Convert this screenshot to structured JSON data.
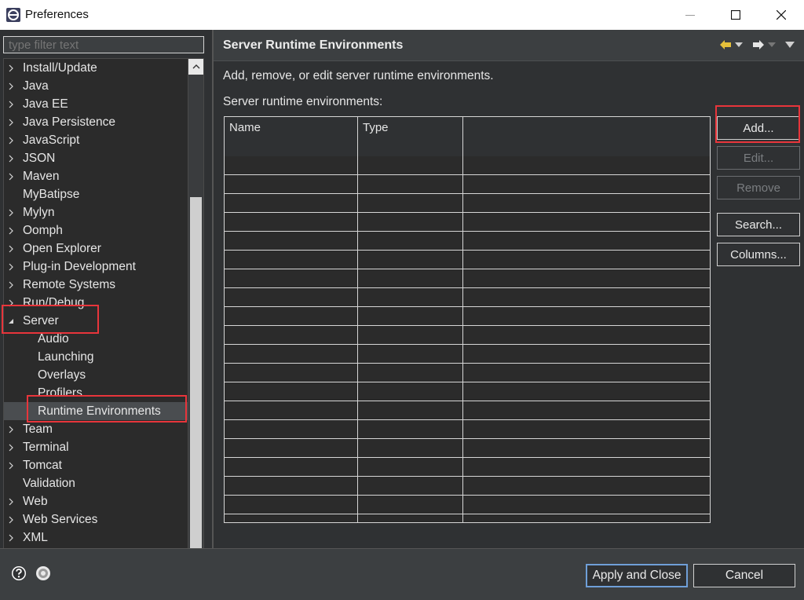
{
  "window": {
    "title": "Preferences"
  },
  "sidebar": {
    "filter_placeholder": "type filter text",
    "items": [
      {
        "label": "Install/Update",
        "expandable": true
      },
      {
        "label": "Java",
        "expandable": true
      },
      {
        "label": "Java EE",
        "expandable": true
      },
      {
        "label": "Java Persistence",
        "expandable": true
      },
      {
        "label": "JavaScript",
        "expandable": true
      },
      {
        "label": "JSON",
        "expandable": true
      },
      {
        "label": "Maven",
        "expandable": true
      },
      {
        "label": "MyBatipse",
        "expandable": false
      },
      {
        "label": "Mylyn",
        "expandable": true
      },
      {
        "label": "Oomph",
        "expandable": true
      },
      {
        "label": "Open Explorer",
        "expandable": true
      },
      {
        "label": "Plug-in Development",
        "expandable": true
      },
      {
        "label": "Remote Systems",
        "expandable": true
      },
      {
        "label": "Run/Debug",
        "expandable": true
      },
      {
        "label": "Server",
        "expandable": true,
        "expanded": true
      },
      {
        "label": "Audio",
        "child": true
      },
      {
        "label": "Launching",
        "child": true
      },
      {
        "label": "Overlays",
        "child": true
      },
      {
        "label": "Profilers",
        "child": true
      },
      {
        "label": "Runtime Environments",
        "child": true,
        "selected": true
      },
      {
        "label": "Team",
        "expandable": true
      },
      {
        "label": "Terminal",
        "expandable": true
      },
      {
        "label": "Tomcat",
        "expandable": true
      },
      {
        "label": "Validation",
        "expandable": false
      },
      {
        "label": "Web",
        "expandable": true
      },
      {
        "label": "Web Services",
        "expandable": true
      },
      {
        "label": "XML",
        "expandable": true
      }
    ]
  },
  "main": {
    "title": "Server Runtime Environments",
    "description": "Add, remove, or edit server runtime environments.",
    "table_label": "Server runtime environments:",
    "columns": [
      "Name",
      "Type",
      ""
    ],
    "rows": []
  },
  "buttons": {
    "add": "Add...",
    "edit": "Edit...",
    "remove": "Remove",
    "search": "Search...",
    "columns": "Columns..."
  },
  "footer": {
    "apply_close": "Apply and Close",
    "cancel": "Cancel"
  },
  "colors": {
    "background": "#2f3133",
    "highlight": "#e8353b",
    "default_button_border": "#6f9fd8"
  },
  "icons": {
    "window": "eclipse-icon",
    "help": "help-icon",
    "import_export": "preferences-io-icon",
    "back": "back-arrow-icon",
    "forward": "forward-arrow-icon"
  }
}
